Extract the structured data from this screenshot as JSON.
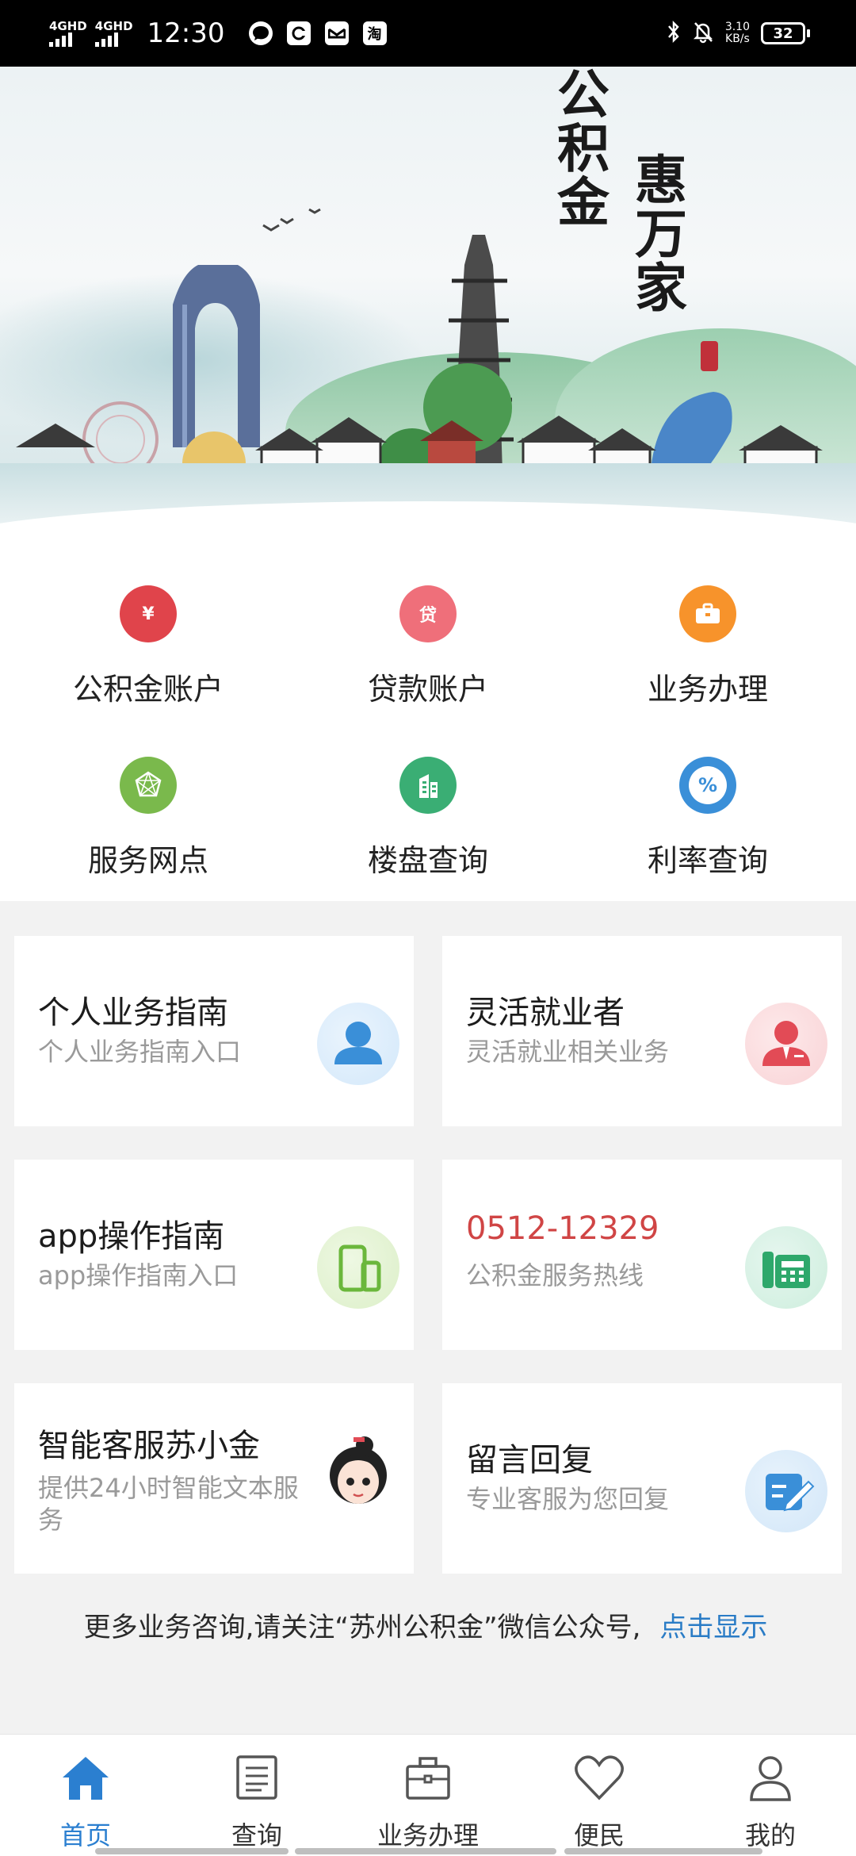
{
  "status_bar": {
    "network1": "4GHD",
    "network2": "4GHD",
    "time": "12:30",
    "notif_icons": [
      "chat-bubble-icon",
      "app-c-icon",
      "mail-icon",
      "taobao-icon"
    ],
    "taobao_glyph": "淘",
    "speed_value": "3.10",
    "speed_unit": "KB/s",
    "battery": "32"
  },
  "banner": {
    "calligraphy_left": "公积金",
    "calligraphy_right": "惠万家"
  },
  "grid": [
    {
      "label": "公积金账户",
      "icon": "money-bag-icon",
      "glyph": "¥",
      "color": "#e0444b"
    },
    {
      "label": "贷款账户",
      "icon": "loan-bag-icon",
      "glyph": "贷",
      "color": "#ef6f7a"
    },
    {
      "label": "业务办理",
      "icon": "briefcase-icon",
      "glyph": "▭",
      "color": "#f7932b"
    },
    {
      "label": "服务网点",
      "icon": "network-icon",
      "glyph": "✲",
      "color": "#7ab94c"
    },
    {
      "label": "楼盘查询",
      "icon": "building-icon",
      "glyph": "▤",
      "color": "#3aae74"
    },
    {
      "label": "利率查询",
      "icon": "percent-icon",
      "glyph": "%",
      "color": "#3a8fd8"
    }
  ],
  "cards": [
    {
      "title": "个人业务指南",
      "subtitle": "个人业务指南入口",
      "icon": "person-icon"
    },
    {
      "title": "灵活就业者",
      "subtitle": "灵活就业相关业务",
      "icon": "worker-icon"
    },
    {
      "title": "app操作指南",
      "subtitle": "app操作指南入口",
      "icon": "phone-devices-icon"
    },
    {
      "title": "0512-12329",
      "subtitle": "公积金服务热线",
      "icon": "telephone-icon"
    },
    {
      "title": "智能客服苏小金",
      "subtitle": "提供24小时智能文本服务",
      "icon": "assistant-avatar-icon"
    },
    {
      "title": "留言回复",
      "subtitle": "专业客服为您回复",
      "icon": "edit-note-icon"
    }
  ],
  "more_info": {
    "text": "更多业务咨询,请关注“苏州公积金”微信公众号,",
    "link": "点击显示"
  },
  "tabs": [
    {
      "label": "首页",
      "icon": "home-icon",
      "active": true
    },
    {
      "label": "查询",
      "icon": "document-icon",
      "active": false
    },
    {
      "label": "业务办理",
      "icon": "briefcase-icon",
      "active": false
    },
    {
      "label": "便民",
      "icon": "heart-icon",
      "active": false
    },
    {
      "label": "我的",
      "icon": "user-icon",
      "active": false
    }
  ]
}
